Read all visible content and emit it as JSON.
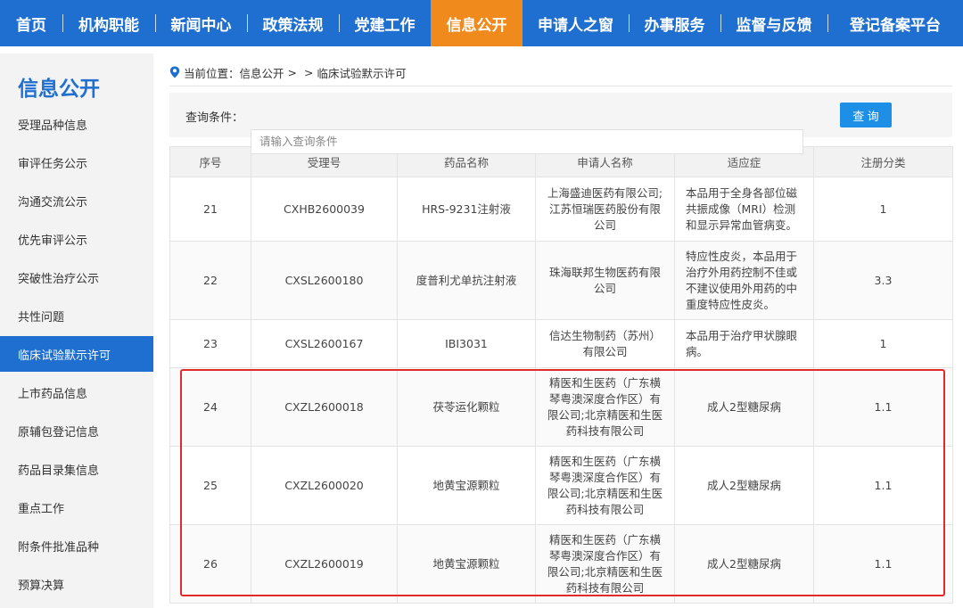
{
  "nav": {
    "items": [
      {
        "label": "首页",
        "active": false
      },
      {
        "label": "机构职能",
        "active": false
      },
      {
        "label": "新闻中心",
        "active": false
      },
      {
        "label": "政策法规",
        "active": false
      },
      {
        "label": "党建工作",
        "active": false
      },
      {
        "label": "信息公开",
        "active": true
      },
      {
        "label": "申请人之窗",
        "active": false
      },
      {
        "label": "办事服务",
        "active": false
      },
      {
        "label": "监督与反馈",
        "active": false
      },
      {
        "label": "登记备案平台",
        "active": false
      }
    ]
  },
  "sidebar": {
    "title": "信息公开",
    "items": [
      {
        "label": "受理品种信息"
      },
      {
        "label": "审评任务公示"
      },
      {
        "label": "沟通交流公示"
      },
      {
        "label": "优先审评公示"
      },
      {
        "label": "突破性治疗公示"
      },
      {
        "label": "共性问题"
      },
      {
        "label": "临床试验默示许可"
      },
      {
        "label": "上市药品信息"
      },
      {
        "label": "原辅包登记信息"
      },
      {
        "label": "药品目录集信息"
      },
      {
        "label": "重点工作"
      },
      {
        "label": "附条件批准品种"
      },
      {
        "label": "预算决算"
      }
    ]
  },
  "breadcrumb": {
    "prefix": "当前位置：",
    "section": "信息公开",
    "separator": ">",
    "separator2": ">",
    "current": "临床试验默示许可"
  },
  "query": {
    "label": "查询条件：",
    "placeholder": "请输入查询条件",
    "button_label": "查 询"
  },
  "table": {
    "headers": [
      "序号",
      "受理号",
      "药品名称",
      "申请人名称",
      "适应症",
      "注册分类"
    ],
    "rows": [
      {
        "no": "21",
        "acceptance_no": "CXHB2600039",
        "drug": "HRS-9231注射液",
        "applicant": "上海盛迪医药有限公司;江苏恒瑞医药股份有限公司",
        "indication": "本品用于全身各部位磁共振成像（MRI）检测和显示异常血管病变。",
        "category": "1"
      },
      {
        "no": "22",
        "acceptance_no": "CXSL2600180",
        "drug": "度普利尤单抗注射液",
        "applicant": "珠海联邦生物医药有限公司",
        "indication": "特应性皮炎，本品用于治疗外用药控制不佳或不建议使用外用药的中重度特应性皮炎。",
        "category": "3.3"
      },
      {
        "no": "23",
        "acceptance_no": "CXSL2600167",
        "drug": "IBI3031",
        "applicant": "信达生物制药（苏州）有限公司",
        "indication": "本品用于治疗甲状腺眼病。",
        "category": "1"
      },
      {
        "no": "24",
        "acceptance_no": "CXZL2600018",
        "drug": "茯苓运化颗粒",
        "applicant": "精医和生医药（广东横琴粤澳深度合作区）有限公司;北京精医和生医药科技有限公司",
        "indication": "成人2型糖尿病",
        "category": "1.1"
      },
      {
        "no": "25",
        "acceptance_no": "CXZL2600020",
        "drug": "地黄宝源颗粒",
        "applicant": "精医和生医药（广东横琴粤澳深度合作区）有限公司;北京精医和生医药科技有限公司",
        "indication": "成人2型糖尿病",
        "category": "1.1"
      },
      {
        "no": "26",
        "acceptance_no": "CXZL2600019",
        "drug": "地黄宝源颗粒",
        "applicant": "精医和生医药（广东横琴粤澳深度合作区）有限公司;北京精医和生医药科技有限公司",
        "indication": "成人2型糖尿病",
        "category": "1.1"
      }
    ]
  },
  "colors": {
    "nav_bg": "#1f6fd1",
    "nav_active": "#f08a1c",
    "sidebar_active": "#1f6fd1",
    "query_button": "#1d8fe6",
    "highlight": "#e32a2a"
  }
}
